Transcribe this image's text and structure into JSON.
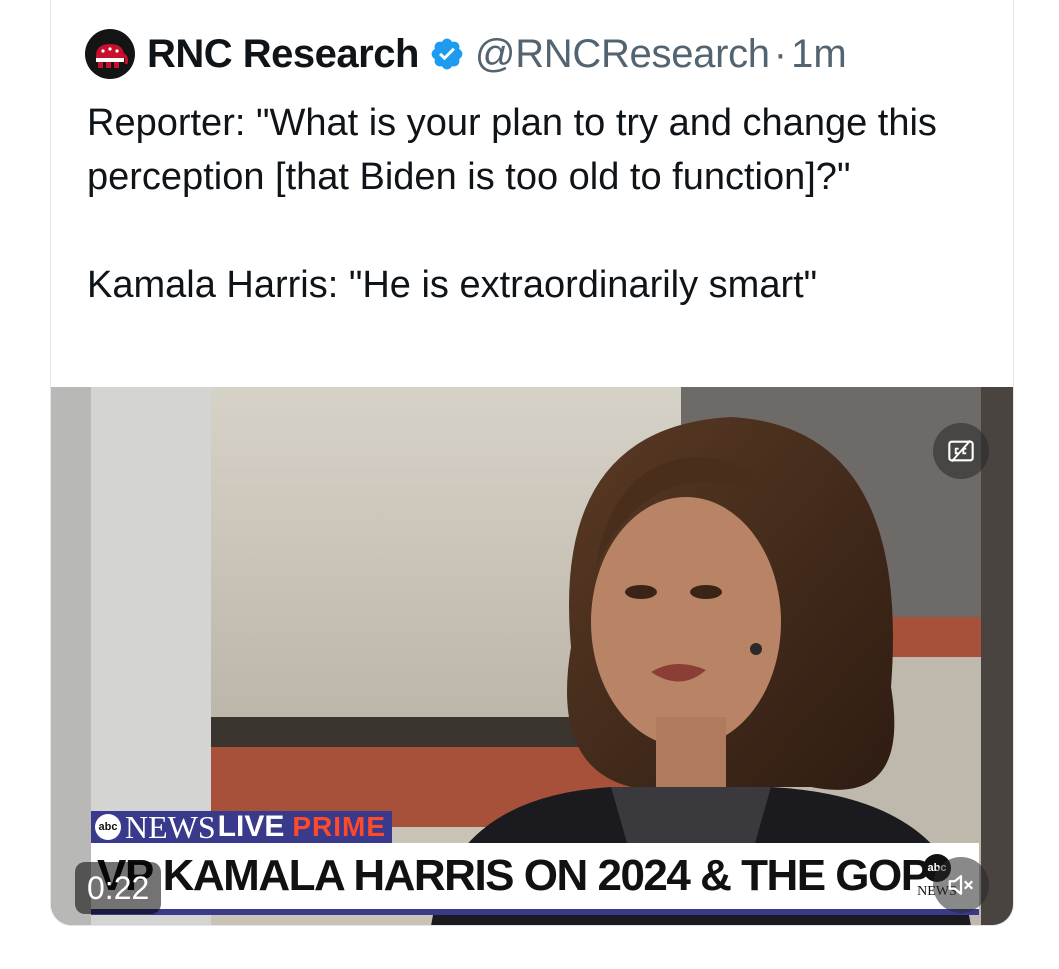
{
  "tweet": {
    "author_name": "RNC Research",
    "handle": "@RNCResearch",
    "separator": "·",
    "time": "1m",
    "text": "Reporter: \"What is your plan to try and change this perception [that Biden is too old to function]?\"\n\nKamala Harris: \"He is extraordinarily smart\""
  },
  "video": {
    "network_bug": {
      "abc": "abc",
      "news": "NEWS",
      "live": "LIVE",
      "prime": "PRIME"
    },
    "headline": "VP KAMALA HARRIS ON 2024 & THE GOP",
    "corner_logo": {
      "abc": "abc",
      "news": "NEWS"
    },
    "timer": "0:22",
    "icons": {
      "captions": "closed-captions-icon",
      "mute": "speaker-muted-icon"
    }
  },
  "colors": {
    "verified_blue": "#1d9bf0",
    "text_primary": "#0f1419",
    "text_secondary": "#536471",
    "rnc_red": "#c8102e",
    "abc_bar": "#3a3a8c",
    "prime_orange": "#ff4a2a"
  }
}
